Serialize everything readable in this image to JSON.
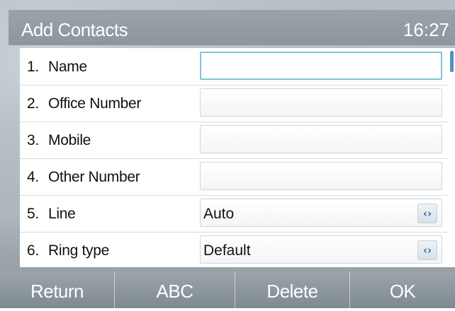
{
  "header": {
    "title": "Add Contacts",
    "time": "16:27"
  },
  "form": {
    "fields": [
      {
        "number": "1.",
        "label": "Name",
        "value": "",
        "type": "text",
        "active": true
      },
      {
        "number": "2.",
        "label": "Office Number",
        "value": "",
        "type": "text"
      },
      {
        "number": "3.",
        "label": "Mobile",
        "value": "",
        "type": "text"
      },
      {
        "number": "4.",
        "label": "Other Number",
        "value": "",
        "type": "text"
      },
      {
        "number": "5.",
        "label": "Line",
        "value": "Auto",
        "type": "select"
      },
      {
        "number": "6.",
        "label": "Ring type",
        "value": "Default",
        "type": "select"
      }
    ],
    "select_arrow_glyph": "‹›"
  },
  "softkeys": {
    "return": "Return",
    "abc": "ABC",
    "delete": "Delete",
    "ok": "OK"
  },
  "colors": {
    "active_border": "#7ec3d8",
    "scroll_thumb": "#4f93c0",
    "arrow": "#2a6fb0"
  }
}
